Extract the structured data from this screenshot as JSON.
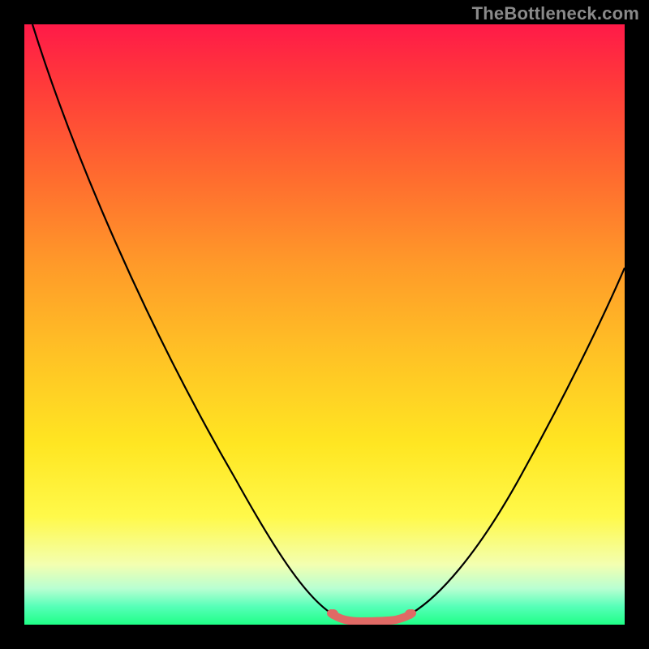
{
  "watermark": {
    "text": "TheBottleneck.com"
  },
  "colors": {
    "frame": "#000000",
    "gradient_top": "#ff1a48",
    "gradient_bottom": "#1fff86",
    "curve": "#000000",
    "curve_highlight": "#e06a65"
  },
  "chart_data": {
    "type": "line",
    "title": "",
    "xlabel": "",
    "ylabel": "",
    "xlim": [
      0,
      100
    ],
    "ylim": [
      0,
      100
    ],
    "grid": false,
    "legend": false,
    "series": [
      {
        "name": "bottleneck-curve",
        "x": [
          0,
          5,
          12,
          20,
          28,
          36,
          44,
          50,
          54,
          58,
          62,
          68,
          74,
          80,
          86,
          92,
          100
        ],
        "y": [
          100,
          88,
          75,
          61,
          46,
          31,
          16,
          5,
          1,
          0,
          0,
          2,
          8,
          17,
          28,
          40,
          59
        ]
      }
    ],
    "highlight_segment": {
      "x_start": 50,
      "x_end": 63,
      "note": "flat trough region"
    }
  }
}
